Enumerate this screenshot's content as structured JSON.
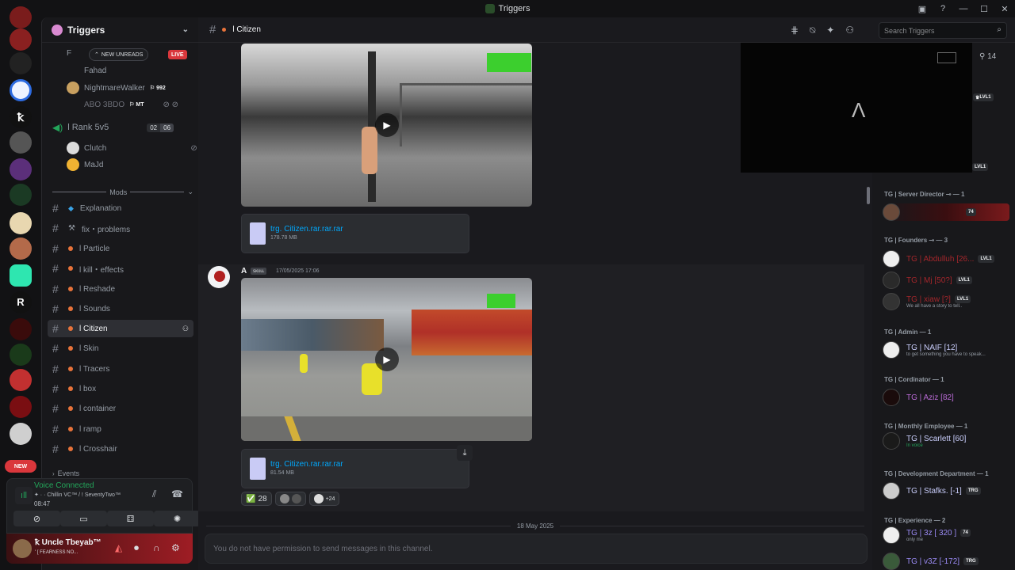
{
  "window": {
    "title": "Triggers",
    "controls": [
      "—",
      "☐",
      "✕"
    ]
  },
  "guild": {
    "name": "Triggers",
    "new_unreads": "NEW UNREADS",
    "live": "LIVE",
    "voice_users": [
      {
        "name": "F",
        "color": "#949ba4"
      },
      {
        "name": "Fahad",
        "color": "#949ba4"
      },
      {
        "name": "NightmareWalker",
        "badge": "992"
      },
      {
        "name": "ABO 3BDO",
        "badge": "MT"
      }
    ],
    "rank_channel": {
      "name": "l Rank 5v5",
      "count_a": "02",
      "count_b": "06"
    },
    "rank_users": [
      "Clutch",
      "MaJd"
    ],
    "category": "Mods",
    "channels": [
      {
        "name": "Explanation",
        "icon": "diamond"
      },
      {
        "name": "fix・problems",
        "icon": "tools"
      },
      {
        "name": "l Particle",
        "icon": "dot"
      },
      {
        "name": "l kill・effects",
        "icon": "dot"
      },
      {
        "name": "l Reshade",
        "icon": "dot"
      },
      {
        "name": "l Sounds",
        "icon": "dot"
      },
      {
        "name": "l Citizen",
        "icon": "dot",
        "active": true
      },
      {
        "name": "l Skin",
        "icon": "dot"
      },
      {
        "name": "l Tracers",
        "icon": "dot"
      },
      {
        "name": "l box",
        "icon": "dot"
      },
      {
        "name": "l container",
        "icon": "dot"
      },
      {
        "name": "l ramp",
        "icon": "dot"
      },
      {
        "name": "l Crosshair",
        "icon": "dot"
      }
    ],
    "events_category": "Events",
    "new_badge": "NEW"
  },
  "voice": {
    "status": "Voice Connected",
    "channel": "✦ · · Chillin VC™ / ! SeventyTwo™",
    "time": "08:47"
  },
  "user": {
    "name": "ꝁ Uncle Tbeyab™",
    "status": "' [ FEARNESS NO..."
  },
  "channel_header": {
    "name": "l Citizen",
    "search_placeholder": "Search Triggers"
  },
  "messages": [
    {
      "file": {
        "name": "trg. Citizen.rar.rar.rar",
        "size": "178.78 MB"
      }
    },
    {
      "author": "A",
      "tag": "ꜱᴋᴜʟʟ",
      "timestamp": "17/05/2025 17:06",
      "file": {
        "name": "trg. Citizen.rar.rar.rar",
        "size": "81.54 MB"
      },
      "reactions": [
        {
          "emoji": "✅",
          "count": "28"
        },
        {
          "count": "+24"
        }
      ]
    }
  ],
  "date_divider": "18 May 2025",
  "composer": {
    "placeholder": "You do not have permission to send messages in this channel."
  },
  "overlay_count": "14",
  "members": {
    "groups": [
      {
        "title": "TG | Server Director ⊸ — 1"
      },
      {
        "title": "TG | Founders ⊸ — 3"
      },
      {
        "title": "TG | Admin — 1"
      },
      {
        "title": "TG | Cordinator — 1"
      },
      {
        "title": "TG | Monthly Employee — 1"
      },
      {
        "title": "TG | Development Department — 1"
      },
      {
        "title": "TG | Experience — 2"
      }
    ],
    "list": [
      {
        "name": "",
        "badge": "74",
        "color": "#da373c"
      },
      {
        "name": "TG | Abdulluh [26...",
        "badge": "LVL1",
        "color": "#a3262b"
      },
      {
        "name": "TG | Mj [50?]",
        "badge": "LVL1",
        "color": "#a3262b"
      },
      {
        "name": "TG | xiaw [?]",
        "badge": "LVL1",
        "sub": "We all have a story to tell..",
        "color": "#a3262b"
      },
      {
        "name": "TG | NAIF [12]",
        "sub": "to get something you have to speak...",
        "color": "#c9cdfb"
      },
      {
        "name": "TG | Aziz [82]",
        "color": "#b86ad4"
      },
      {
        "name": "TG | Scarlett [60]",
        "sub": "In voice",
        "color": "#c9cdfb"
      },
      {
        "name": "TG | Stafks. [-1]",
        "badge": "TRG",
        "color": "#c9cdfb"
      },
      {
        "name": "TG | 3z [ 320 ]",
        "badge": "74",
        "sub": "only me",
        "color": "#9b8bf5"
      },
      {
        "name": "TG | v3Z [-172]",
        "badge": "TRG",
        "color": "#9b8bf5"
      }
    ],
    "lvl_top": "LVL1",
    "lvl_top2": "LVL1"
  },
  "colors": {
    "accent": "#5865f2",
    "link": "#00a8fc",
    "voice_green": "#23a55a",
    "danger": "#da373c"
  }
}
